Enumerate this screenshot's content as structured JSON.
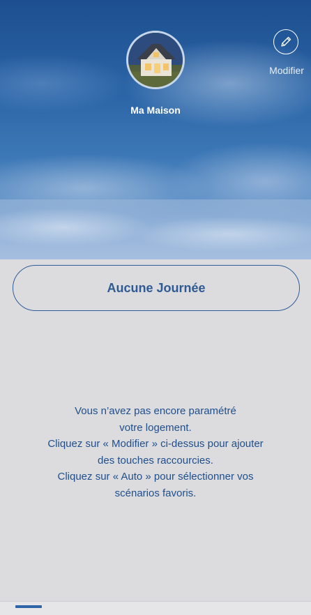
{
  "header": {
    "home_name": "Ma Maison",
    "edit_label": "Modifier"
  },
  "main": {
    "day_button_label": "Aucune Journée",
    "info_lines": [
      "Vous n’avez pas encore paramétré",
      "votre logement.",
      "Cliquez sur « Modifier » ci-dessus pour ajouter",
      "des touches raccourcies.",
      "Cliquez sur « Auto » pour sélectionner vos",
      "scénarios favoris."
    ]
  },
  "icons": {
    "avatar": "house-photo",
    "edit": "pencil-icon"
  },
  "colors": {
    "accent": "#2f5a93",
    "text": "#1f4e8c",
    "background": "#dcdcdf"
  }
}
